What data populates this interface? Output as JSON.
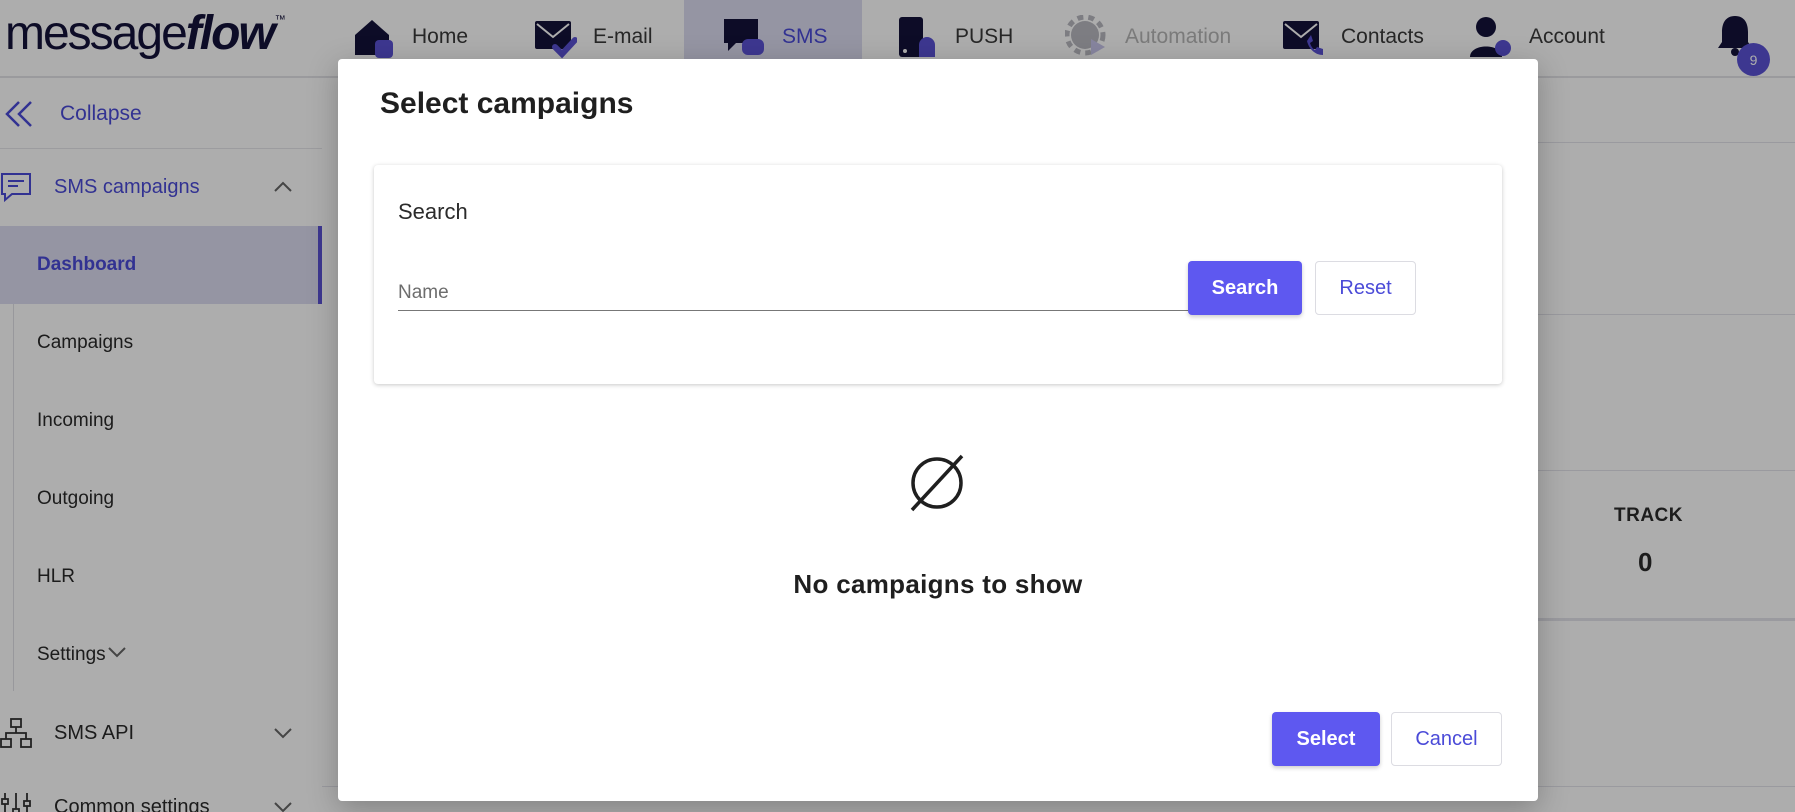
{
  "colors": {
    "accent": "#5e58f0",
    "active_bg": "#dcdcf0",
    "brand_dark": "#14123a"
  },
  "logo": {
    "thin": "message",
    "bold": "flow",
    "tm": "™"
  },
  "nav": [
    {
      "label": "Home",
      "icon": "home-icon"
    },
    {
      "label": "E-mail",
      "icon": "email-icon"
    },
    {
      "label": "SMS",
      "icon": "sms-icon",
      "active": true
    },
    {
      "label": "PUSH",
      "icon": "push-icon"
    },
    {
      "label": "Automation",
      "icon": "automation-icon",
      "disabled": true
    },
    {
      "label": "Contacts",
      "icon": "contacts-icon"
    },
    {
      "label": "Account",
      "icon": "account-icon"
    }
  ],
  "notifications": {
    "count": "9",
    "icon": "bell-icon"
  },
  "sidebar": {
    "collapse_label": "Collapse",
    "sms_campaigns": "SMS campaigns",
    "items": [
      "Dashboard",
      "Campaigns",
      "Incoming",
      "Outgoing",
      "HLR",
      "Settings"
    ],
    "active_item": "Dashboard",
    "sms_api": "SMS API",
    "common_settings": "Common settings"
  },
  "background": {
    "track_label": "TRACK",
    "track_value": "0"
  },
  "modal": {
    "title": "Select campaigns",
    "search_heading": "Search",
    "name_placeholder": "Name",
    "name_value": "",
    "search_button": "Search",
    "reset_button": "Reset",
    "empty_icon": "empty-set-icon",
    "empty_text": "No campaigns to show",
    "select_button": "Select",
    "cancel_button": "Cancel"
  }
}
